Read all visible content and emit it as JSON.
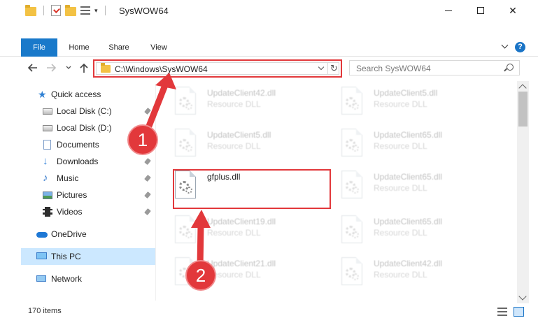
{
  "window": {
    "title": "SysWOW64",
    "minimize_icon": "minimize-icon",
    "maximize_icon": "maximize-icon",
    "close_symbol": "✕"
  },
  "ribbon": {
    "tabs": [
      {
        "label": "File"
      },
      {
        "label": "Home"
      },
      {
        "label": "Share"
      },
      {
        "label": "View"
      }
    ],
    "help_symbol": "?"
  },
  "address_bar": {
    "path": "C:\\Windows\\SysWOW64",
    "refresh_symbol": "↻"
  },
  "search": {
    "placeholder": "Search SysWOW64"
  },
  "sidebar": {
    "items": [
      {
        "label": "Quick access",
        "icon": "star-icon"
      },
      {
        "label": "Local Disk (C:)",
        "icon": "drive-icon",
        "pinned": true
      },
      {
        "label": "Local Disk (D:)",
        "icon": "drive-icon",
        "pinned": true
      },
      {
        "label": "Documents",
        "icon": "document-icon",
        "pinned": true
      },
      {
        "label": "Downloads",
        "icon": "download-icon",
        "pinned": true
      },
      {
        "label": "Music",
        "icon": "music-icon",
        "pinned": true
      },
      {
        "label": "Pictures",
        "icon": "pictures-icon",
        "pinned": true
      },
      {
        "label": "Videos",
        "icon": "videos-icon",
        "pinned": true
      },
      {
        "label": "OneDrive",
        "icon": "onedrive-icon"
      },
      {
        "label": "This PC",
        "icon": "this-pc-icon",
        "selected": true
      },
      {
        "label": "Network",
        "icon": "network-icon"
      }
    ]
  },
  "files": [
    {
      "name": "UpdateClient42.dll",
      "type": "Resource DLL"
    },
    {
      "name": "UpdateClient5.dll",
      "type": "Resource DLL"
    },
    {
      "name": "UpdateClient5.dll",
      "type": "Resource DLL"
    },
    {
      "name": "UpdateClient65.dll",
      "type": "Resource DLL"
    },
    {
      "name": "gfplus.dll",
      "type": ""
    },
    {
      "name": "UpdateClient65.dll",
      "type": "Resource DLL"
    },
    {
      "name": "UpdateClient19.dll",
      "type": "Resource DLL"
    },
    {
      "name": "UpdateClient65.dll",
      "type": "Resource DLL"
    },
    {
      "name": "UpdateClient21.dll",
      "type": "Resource DLL"
    },
    {
      "name": "UpdateClient42.dll",
      "type": "Resource DLL"
    }
  ],
  "status": {
    "item_count": "170 items"
  },
  "annotations": {
    "badge_1": "1",
    "badge_2": "2",
    "color": "#e2383b"
  }
}
